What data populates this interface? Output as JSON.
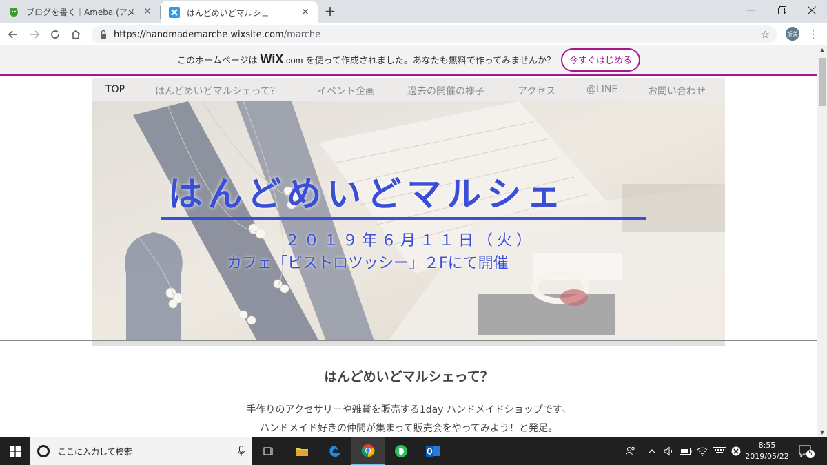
{
  "browser": {
    "tabs": [
      {
        "title": "ブログを書く｜Ameba (アメーバ)",
        "active": false
      },
      {
        "title": "はんどめいどマルシェ",
        "active": true
      }
    ],
    "url_host": "https://handmademarche.wixsite.com",
    "url_path": "/marche",
    "profile_label": "折美"
  },
  "wix_banner": {
    "text_before": "このホームページは",
    "logo_main": "WiX",
    "logo_suffix": ".com",
    "text_after": "を使って作成されました。あなたも無料で作ってみませんか？",
    "button_label": "今すぐはじめる",
    "accent_color": "#a1198f"
  },
  "site_nav": {
    "items": [
      {
        "label": "TOP",
        "current": true
      },
      {
        "label": "はんどめいどマルシェって？",
        "current": false
      },
      {
        "label": "イベント企画",
        "current": false
      },
      {
        "label": "過去の開催の様子",
        "current": false
      },
      {
        "label": "アクセス",
        "current": false
      },
      {
        "label": "@LINE",
        "current": false
      },
      {
        "label": "お問い合わせ",
        "current": false
      }
    ]
  },
  "hero": {
    "title": "はんどめいどマルシェ",
    "date": "２０１９年６月１１日（火）",
    "venue": "カフェ「ビストロツッシー」２Fにて開催",
    "accent_color": "#3b4fd6"
  },
  "about": {
    "heading": "はんどめいどマルシェって？",
    "line1": "手作りのアクセサリーや雑貨を販売する1day ハンドメイドショップです。",
    "line2": "ハンドメイド好きの仲間が集まって販売会をやってみよう！と発足。"
  },
  "taskbar": {
    "search_placeholder": "ここに入力して検索",
    "time": "8:55",
    "date": "2019/05/22",
    "notification_count": "5"
  }
}
